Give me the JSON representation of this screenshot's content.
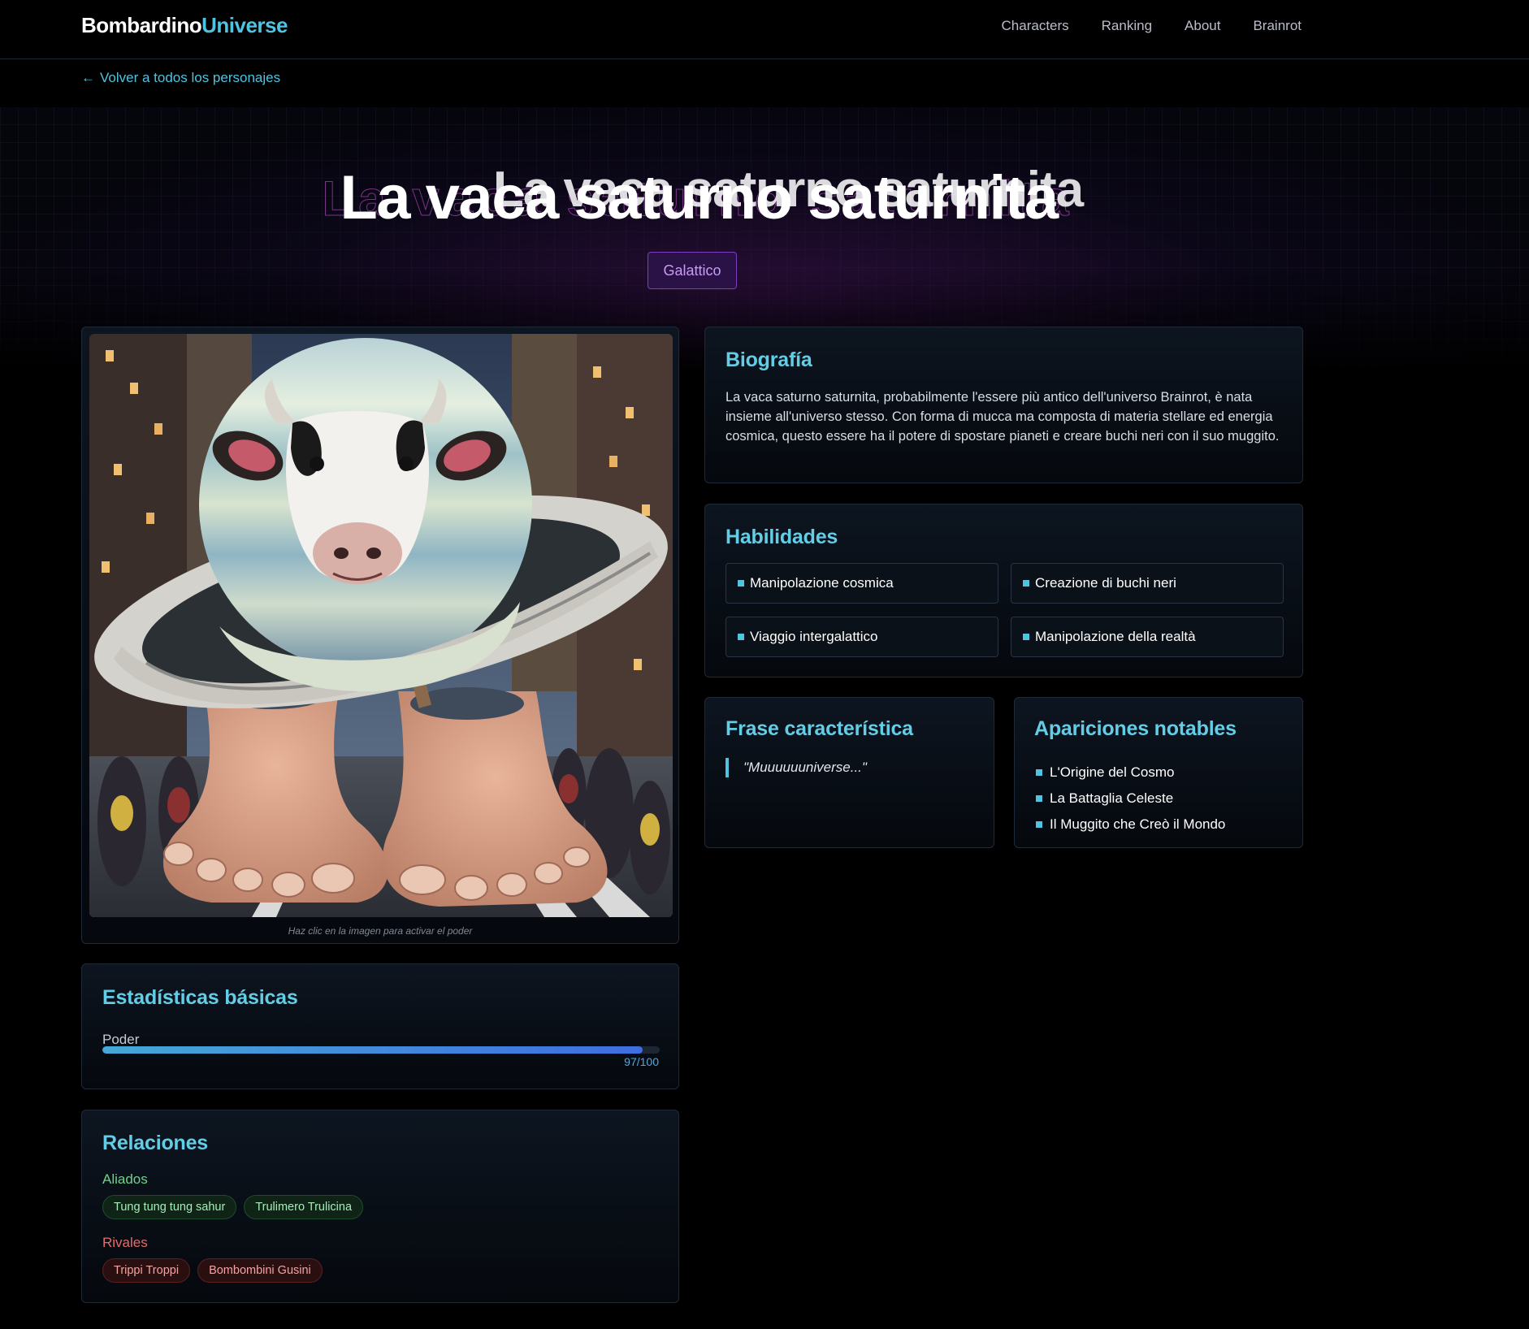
{
  "header": {
    "logo_part1": "Bombardino",
    "logo_part2": "Universe",
    "nav": [
      "Characters",
      "Ranking",
      "About",
      "Brainrot"
    ]
  },
  "back_link": "Volver a todos los personajes",
  "hero": {
    "title": "La vaca saturno saturnita",
    "badge": "Galattico"
  },
  "image": {
    "alt": "La vaca saturno saturnita",
    "caption": "Haz clic en la imagen para activar el poder"
  },
  "biography": {
    "heading": "Biografía",
    "text": "La vaca saturno saturnita, probabilmente l'essere più antico dell'universo Brainrot, è nata insieme all'universo stesso. Con forma di mucca ma composta di materia stellare ed energia cosmica, questo essere ha il potere di spostare pianeti e creare buchi neri con il suo muggito."
  },
  "abilities": {
    "heading": "Habilidades",
    "items": [
      "Manipolazione cosmica",
      "Creazione di buchi neri",
      "Viaggio intergalattico",
      "Manipolazione della realtà"
    ]
  },
  "phrase": {
    "heading": "Frase característica",
    "quote": "\"Muuuuuuniverse...\""
  },
  "appearances": {
    "heading": "Apariciones notables",
    "items": [
      "L'Origine del Cosmo",
      "La Battaglia Celeste",
      "Il Muggito che Creò il Mondo"
    ]
  },
  "stats": {
    "heading": "Estadísticas básicas",
    "label": "Poder",
    "value": 97,
    "max": 100,
    "value_text": "97/100"
  },
  "relations": {
    "heading": "Relaciones",
    "allies_label": "Aliados",
    "allies": [
      "Tung tung tung sahur",
      "Trulimero Trulicina"
    ],
    "rivals_label": "Rivales",
    "rivals": [
      "Trippi Troppi",
      "Bombombini Gusini"
    ]
  },
  "colors": {
    "accent": "#4fc3e0",
    "badge_bg": "#2a1146",
    "badge_text": "#c79cf5",
    "ally": "#6dd28a",
    "rival": "#e46b6b"
  }
}
